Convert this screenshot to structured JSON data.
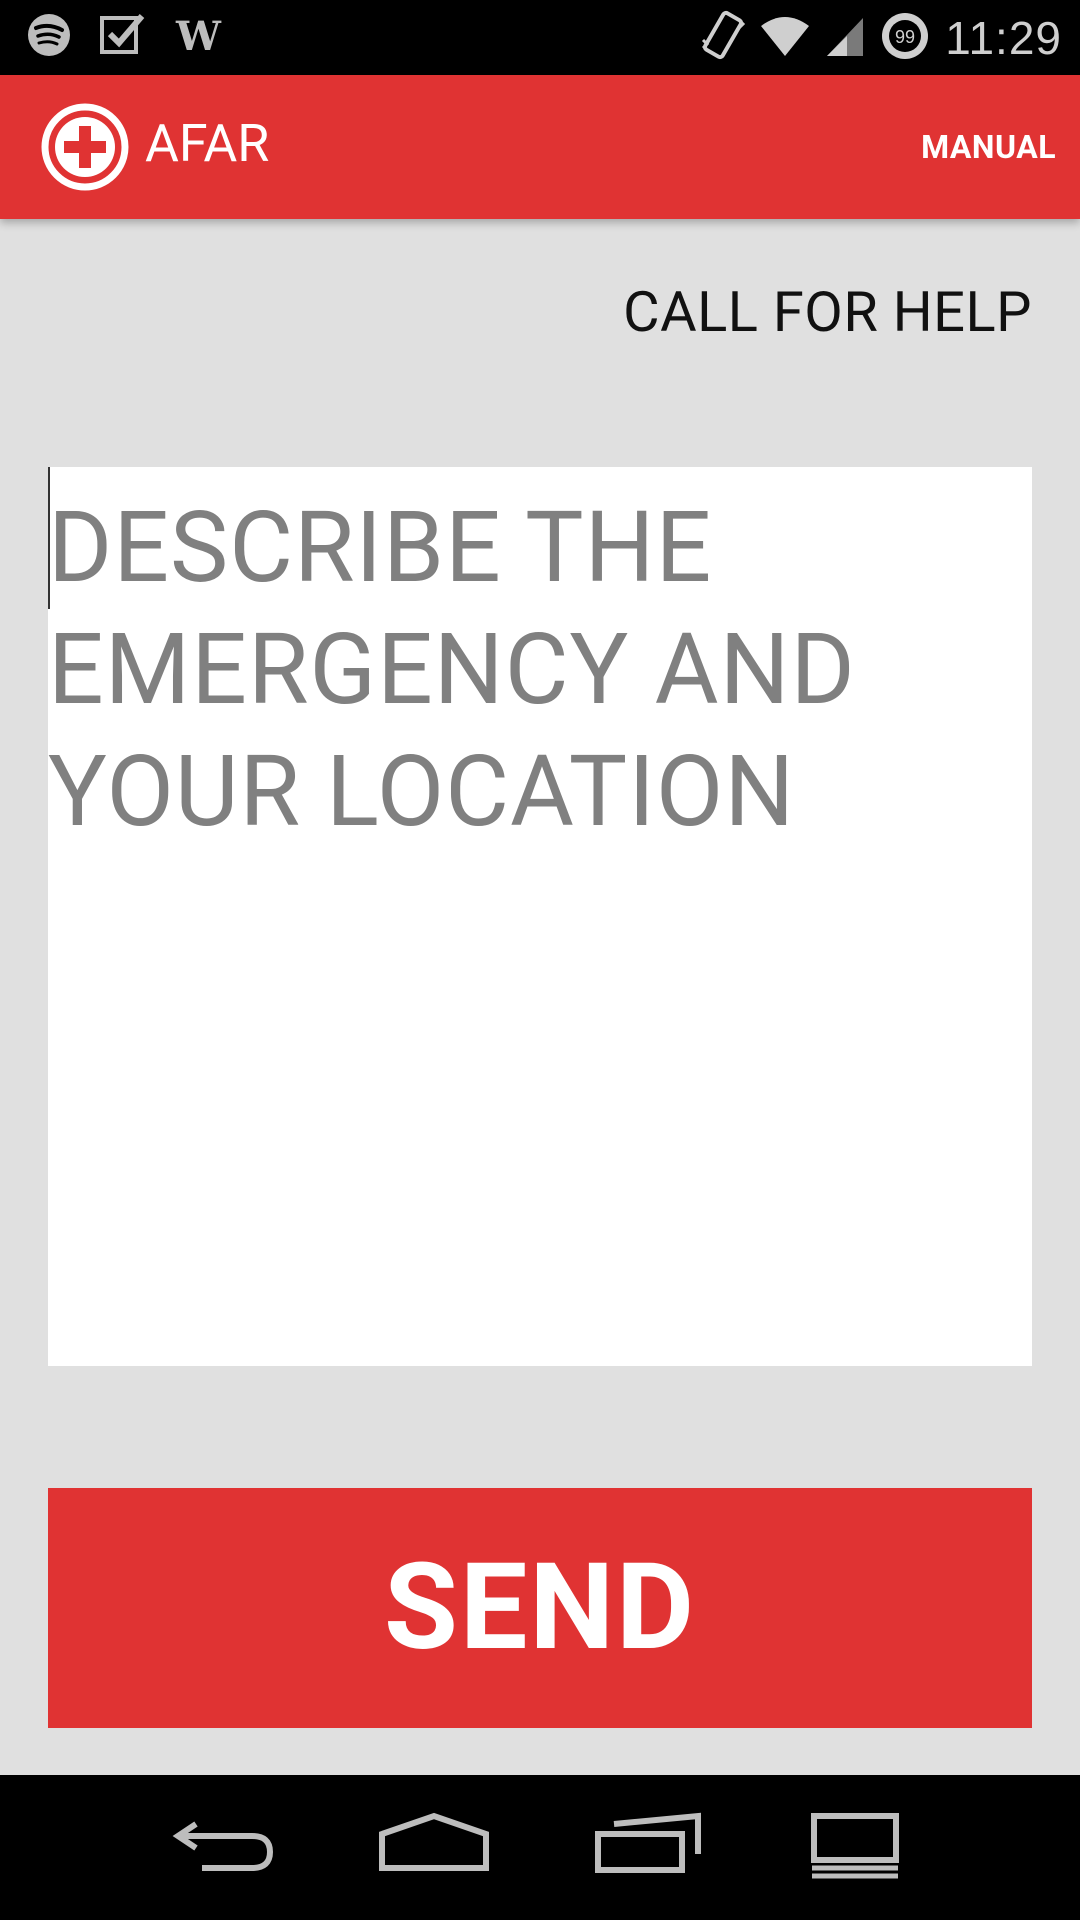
{
  "status_bar": {
    "time": "11:29",
    "notification_icons": [
      "spotify-icon",
      "checkbox-icon",
      "wikipedia-icon"
    ],
    "system_icons": [
      "vibrate-icon",
      "wifi-icon",
      "signal-icon",
      "battery-icon"
    ],
    "battery_level": "99"
  },
  "app_bar": {
    "title": "AFAR",
    "action_label": "MANUAL",
    "logo_icon": "plus-circle-icon",
    "background_color": "#e03333"
  },
  "main": {
    "heading": "CALL FOR HELP",
    "message_placeholder": "DESCRIBE THE EMERGENCY AND YOUR LOCATION",
    "message_value": "",
    "send_label": "SEND"
  },
  "nav_bar": {
    "icons": [
      "back-icon",
      "home-icon",
      "recents-icon",
      "keyboard-icon"
    ]
  }
}
